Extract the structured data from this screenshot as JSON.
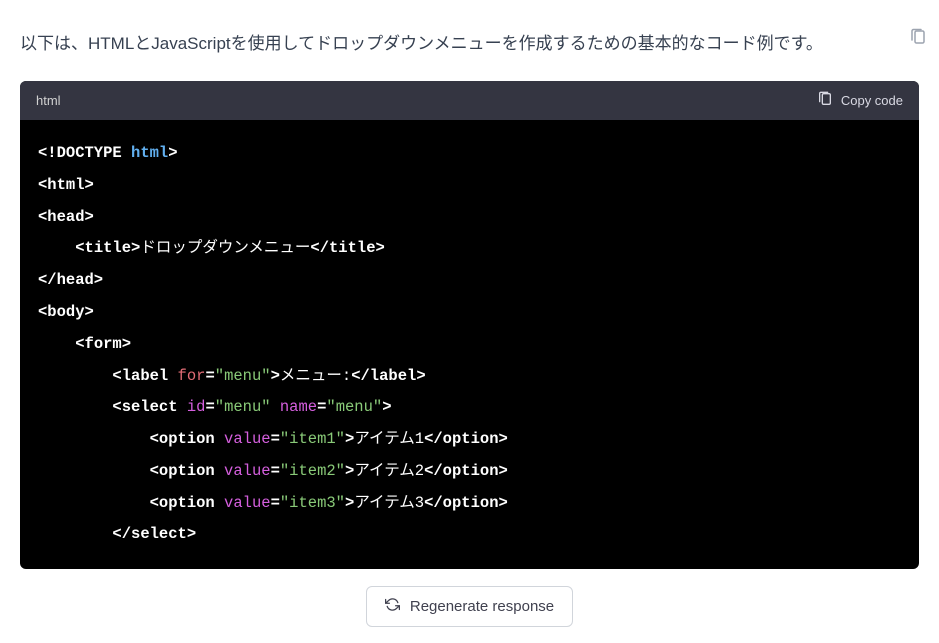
{
  "intro": "以下は、HTMLとJavaScriptを使用してドロップダウンメニューを作成するための基本的なコード例です。",
  "code_header": {
    "lang": "html",
    "copy_label": "Copy code"
  },
  "code": {
    "line1_doctype": "<!DOCTYPE",
    "line1_html": " html",
    "line1_close": ">",
    "line2": "<html>",
    "line3": "<head>",
    "line4_open": "<title>",
    "line4_text": "ドロップダウンメニュー",
    "line4_close": "</title>",
    "line5": "</head>",
    "line6": "<body>",
    "line7": "<form>",
    "line8_open": "<label",
    "line8_attr": " for",
    "line8_eq": "=",
    "line8_val": "\"menu\"",
    "line8_close1": ">",
    "line8_text": "メニュー:",
    "line8_close2": "</label>",
    "line9_open": "<select",
    "line9_attr1": " id",
    "line9_val1": "\"menu\"",
    "line9_attr2": " name",
    "line9_val2": "\"menu\"",
    "line9_close": ">",
    "line10_open": "<option",
    "line10_attr": " value",
    "line10_val": "\"item1\"",
    "line10_close1": ">",
    "line10_text": "アイテム1",
    "line10_close2": "</option>",
    "line11_open": "<option",
    "line11_attr": " value",
    "line11_val": "\"item2\"",
    "line11_close1": ">",
    "line11_text": "アイテム2",
    "line11_close2": "</option>",
    "line12_open": "<option",
    "line12_attr": " value",
    "line12_val": "\"item3\"",
    "line12_close1": ">",
    "line12_text": "アイテム3",
    "line12_close2": "</option>",
    "line13": "</select>"
  },
  "regen_label": "Regenerate response"
}
